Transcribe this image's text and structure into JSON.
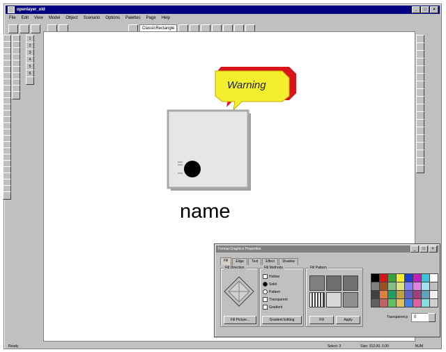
{
  "window": {
    "title": "openlayer_old"
  },
  "menu": [
    "File",
    "Edit",
    "View",
    "Model",
    "Object",
    "Scenario",
    "Options",
    "Palettes",
    "Page",
    "Help"
  ],
  "toolbar": {
    "style_combo": "ClassicRectangle"
  },
  "canvas": {
    "callout_text": "Warning",
    "node_label": "name",
    "colors": {
      "callout_fill": "#f3ef2c",
      "callout_back": "#d8141a",
      "node_fill": "#e6e6e6"
    }
  },
  "left_palette_col2": [
    "1",
    "2",
    "3",
    "4",
    "5",
    "6"
  ],
  "statusbar": {
    "left": "Ready",
    "select": "Select: 3",
    "size": "Size: 312.00, 0.00",
    "mode": "NUM"
  },
  "panel": {
    "title": "Format Graphics Properties",
    "tabs": [
      "Fill",
      "Edge",
      "Text",
      "Effect",
      "Shadow"
    ],
    "active_tab": "Fill",
    "fill_direction_label": "Fill Direction",
    "fill_methods_label": "Fill Methods",
    "methods": [
      "Hollow",
      "Solid",
      "Pattern",
      "Transparent",
      "Gradient"
    ],
    "selected_method": "Solid",
    "fill_pattern_label": "Fill Pattern",
    "buttons": {
      "fill_picture": "Fill Picture...",
      "gradient": "Gradient Editing",
      "fill": "Fill",
      "apply": "Apply"
    },
    "transparency_label": "Transparency",
    "transparency_value": "0",
    "palette": [
      "#000000",
      "#d8141a",
      "#3aa03a",
      "#f3ef2c",
      "#2040d0",
      "#c020c0",
      "#40c0e0",
      "#ffffff",
      "#808080",
      "#a05020",
      "#80c080",
      "#e0e080",
      "#8080ff",
      "#e080e0",
      "#a0e0f0",
      "#c0c0c0",
      "#404040",
      "#e08040",
      "#20a060",
      "#c0a040",
      "#6060c0",
      "#a04080",
      "#60a0c0",
      "#f0f0f0",
      "#606060",
      "#c06060",
      "#60c060",
      "#e0c060",
      "#4080e0",
      "#e060a0",
      "#80e0e0",
      "#d0d0d0"
    ]
  }
}
